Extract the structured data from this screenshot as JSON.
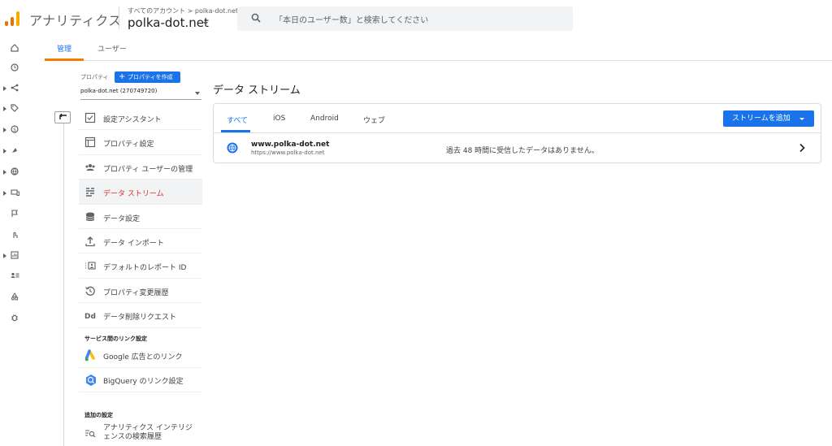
{
  "header": {
    "app_name": "アナリティクス",
    "breadcrumb": "すべてのアカウント > polka-dot.net",
    "account_name": "polka-dot.net",
    "search_placeholder": "「本日のユーザー数」と検索してください",
    "logo_colors": [
      "#f9ab00",
      "#e37400",
      "#e37400"
    ]
  },
  "left_rail": {
    "icons": [
      "home-icon",
      "clock-icon",
      "share-nodes-icon",
      "tag-icon",
      "dollar-icon",
      "pointer-icon",
      "globe-icon",
      "devices-icon",
      "flag-icon",
      "touch-icon",
      "report-icon",
      "audience-list-icon",
      "shapes-icon",
      "bug-icon"
    ]
  },
  "top_tabs": [
    {
      "label": "管理",
      "active": true
    },
    {
      "label": "ユーザー",
      "active": false
    }
  ],
  "property": {
    "label": "プロパティ",
    "create_button": "プロパティを作成",
    "selected": "polka-dot.net (270749720)"
  },
  "menu": [
    {
      "label": "設定アシスタント",
      "icon": "checkbox-icon",
      "active": false
    },
    {
      "label": "プロパティ設定",
      "icon": "property-settings-icon",
      "active": false
    },
    {
      "label": "プロパティ ユーザーの管理",
      "icon": "users-icon",
      "active": false
    },
    {
      "label": "データ ストリーム",
      "icon": "data-stream-icon",
      "active": true
    },
    {
      "label": "データ設定",
      "icon": "database-icon",
      "active": false
    },
    {
      "label": "データ インポート",
      "icon": "upload-icon",
      "active": false
    },
    {
      "label": "デフォルトのレポート ID",
      "icon": "report-id-icon",
      "active": false
    },
    {
      "label": "プロパティ変更履歴",
      "icon": "history-icon",
      "active": false
    },
    {
      "label": "データ削除リクエスト",
      "icon": "dd-icon",
      "active": false
    }
  ],
  "links_section": {
    "title": "サービス間のリンク設定",
    "items": [
      {
        "label": "Google 広告とのリンク",
        "icon": "google-ads-icon"
      },
      {
        "label": "BigQuery のリンク設定",
        "icon": "bigquery-icon"
      }
    ]
  },
  "extra_section": {
    "title": "追加の設定",
    "item_line1": "アナリティクス インテリジ",
    "item_line2": "ェンスの検索履歴"
  },
  "main": {
    "title": "データ ストリーム",
    "tabs": [
      {
        "label": "すべて",
        "active": true
      },
      {
        "label": "iOS",
        "active": false
      },
      {
        "label": "Android",
        "active": false
      },
      {
        "label": "ウェブ",
        "active": false
      }
    ],
    "add_stream_button": "ストリームを追加",
    "streams": [
      {
        "name": "www.polka-dot.net",
        "url": "https://www.polka-dot.net",
        "status": "過去 48 時間に受信したデータはありません。"
      }
    ]
  },
  "colors": {
    "accent": "#1a73e8",
    "active_menu_text": "#d93025",
    "tab_underline_orange": "#f57c00"
  }
}
